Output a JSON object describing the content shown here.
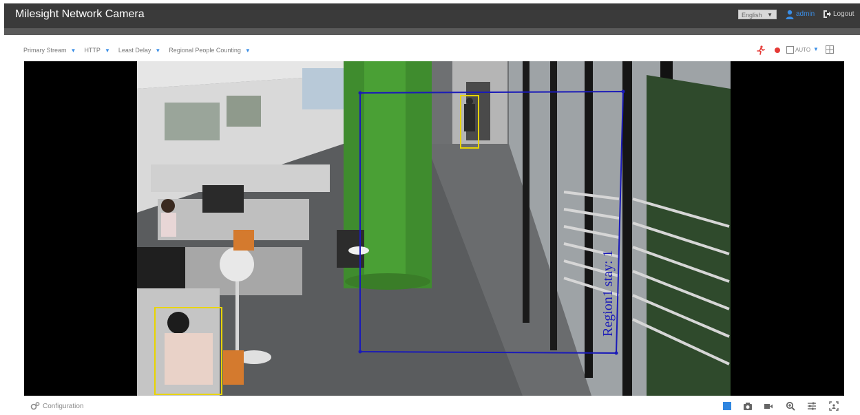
{
  "header": {
    "title": "Milesight Network Camera",
    "language": "English",
    "username": "admin",
    "logout_label": "Logout"
  },
  "toolbar": {
    "stream": "Primary Stream",
    "protocol": "HTTP",
    "delay": "Least Delay",
    "mode": "Regional People Counting",
    "auto_label": "AUTO"
  },
  "video": {
    "region_label": "Region1   stay: 1"
  },
  "footer": {
    "configuration_label": "Configuration"
  },
  "colors": {
    "accent": "#3a8ee6",
    "topbar": "#3a3a3a",
    "region": "#1a1ab8",
    "detection_box": "#e8d400",
    "record": "#e53935"
  },
  "icons": [
    "user-icon",
    "logout-icon",
    "running-person-icon",
    "record-icon",
    "fullscreen-icon",
    "grid-icon",
    "gear-icon",
    "stop-icon",
    "camera-icon",
    "video-icon",
    "zoom-icon",
    "settings-sliders-icon",
    "target-icon"
  ]
}
